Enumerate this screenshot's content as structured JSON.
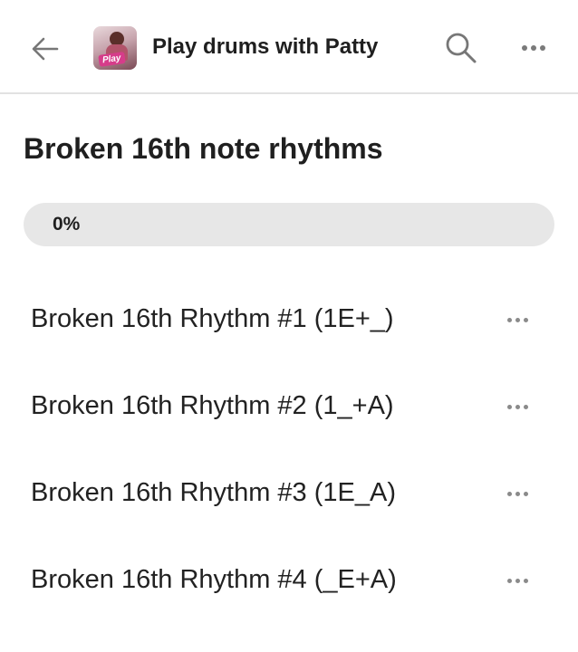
{
  "header": {
    "title": "Play drums with Patty",
    "avatar_icon": "channel-avatar",
    "avatar_stamp": "Play",
    "back_icon": "arrow-left-icon",
    "search_icon": "search-icon",
    "more_icon": "more-horizontal-icon"
  },
  "playlist": {
    "title": "Broken 16th note rhythms",
    "progress_label": "0%",
    "progress_value": 0
  },
  "lessons": [
    {
      "label": "Broken 16th Rhythm #1 (1E+_)"
    },
    {
      "label": "Broken 16th Rhythm #2 (1_+A)"
    },
    {
      "label": "Broken 16th Rhythm #3 (1E_A)"
    },
    {
      "label": "Broken 16th Rhythm #4 (_E+A)"
    }
  ],
  "colors": {
    "text": "#1f1f1f",
    "divider": "#e2e2e2",
    "progress_track": "#e7e7e7",
    "icon": "#7a7a7a"
  }
}
